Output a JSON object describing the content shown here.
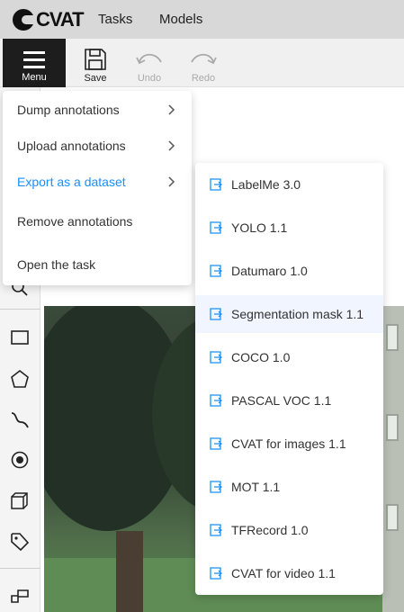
{
  "header": {
    "logo_text": "CVAT",
    "nav": [
      "Tasks",
      "Models"
    ]
  },
  "toolbar": {
    "menu_label": "Menu",
    "save_label": "Save",
    "undo_label": "Undo",
    "redo_label": "Redo"
  },
  "menu": {
    "items": [
      {
        "label": "Dump annotations",
        "has_submenu": true
      },
      {
        "label": "Upload annotations",
        "has_submenu": true
      },
      {
        "label": "Export as a dataset",
        "has_submenu": true,
        "active": true
      },
      {
        "label": "Remove annotations",
        "has_submenu": false
      },
      {
        "label": "Open the task",
        "has_submenu": false
      }
    ]
  },
  "export_submenu": {
    "items": [
      "LabelMe 3.0",
      "YOLO 1.1",
      "Datumaro 1.0",
      "Segmentation mask 1.1",
      "COCO 1.0",
      "PASCAL VOC 1.1",
      "CVAT for images 1.1",
      "MOT 1.1",
      "TFRecord 1.0",
      "CVAT for video 1.1"
    ],
    "hovered_index": 3
  },
  "sidebar": {
    "tools": [
      "zoom-icon",
      "rectangle-icon",
      "polygon-icon",
      "polyline-icon",
      "points-icon",
      "cuboid-icon",
      "tag-icon",
      "split-icon"
    ]
  },
  "colors": {
    "accent": "#1890ff",
    "header_bg": "#d8d8d8",
    "menu_button_bg": "#1d1d1d",
    "hover_bg": "#f0f5ff"
  }
}
